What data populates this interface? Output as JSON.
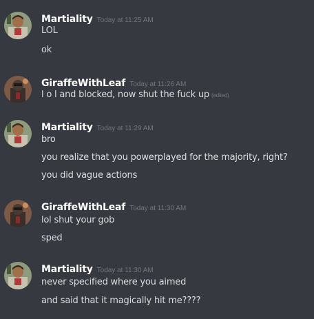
{
  "messages": [
    {
      "username": "Martiality",
      "timestamp": "Today at 11:25 AM",
      "avatar": "martiality-avatar",
      "lines": [
        "LOL",
        "ok"
      ]
    },
    {
      "username": "GiraffeWithLeaf",
      "timestamp": "Today at 11:26 AM",
      "avatar": "giraffewithleaf-avatar",
      "lines": [
        "l o l and blocked, now shut the fuck up"
      ],
      "edited_label": "(edited)"
    },
    {
      "username": "Martiality",
      "timestamp": "Today at 11:29 AM",
      "avatar": "martiality-avatar",
      "lines": [
        "bro",
        "you realize that you powerplayed for the majority, right?",
        "you did vague actions"
      ]
    },
    {
      "username": "GiraffeWithLeaf",
      "timestamp": "Today at 11:30 AM",
      "avatar": "giraffewithleaf-avatar",
      "lines": [
        "lol shut your gob",
        "sped"
      ]
    },
    {
      "username": "Martiality",
      "timestamp": "Today at 11:30 AM",
      "avatar": "martiality-avatar",
      "lines": [
        "never specified where you aimed",
        "and said that it magically hit me????"
      ]
    }
  ],
  "colors": {
    "background": "#36393f",
    "username": "#ffffff",
    "message_text": "#dcddde",
    "timestamp": "#72767d"
  }
}
